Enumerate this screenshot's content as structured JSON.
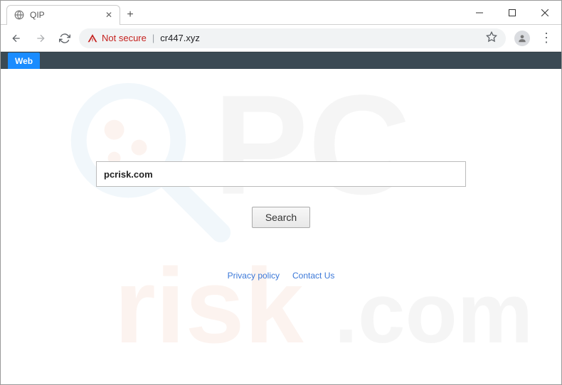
{
  "window": {
    "tab_title": "QIP"
  },
  "toolbar": {
    "not_secure_label": "Not secure",
    "url": "cr447.xyz"
  },
  "page": {
    "tab_label": "Web",
    "search_value": "pcrisk.com",
    "search_button": "Search",
    "footer": {
      "privacy": "Privacy policy",
      "contact": "Contact Us"
    }
  },
  "watermark": {
    "text_top": "PC",
    "text_bottom": "risk.com"
  }
}
